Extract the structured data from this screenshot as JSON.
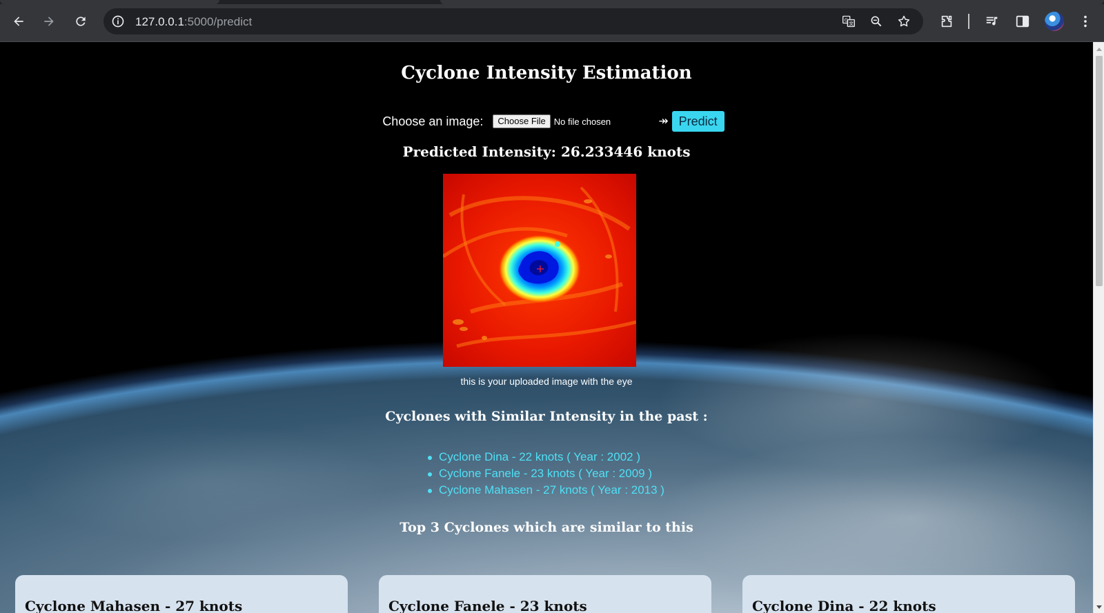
{
  "browser": {
    "url_host": "127.0.0.1",
    "url_path": ":5000/predict",
    "icons": [
      "back-icon",
      "forward-icon",
      "reload-icon",
      "site-info-icon",
      "translate-icon",
      "zoom-icon",
      "bookmark-star-icon",
      "extensions-icon",
      "media-controls-icon",
      "side-panel-icon",
      "profile-avatar",
      "menu-icon"
    ]
  },
  "page": {
    "title": "Cyclone Intensity Estimation",
    "upload": {
      "label": "Choose an image:",
      "choose_button": "Choose File",
      "file_status": "No file chosen",
      "arrow": "↠",
      "predict_button": "Predict"
    },
    "predicted_intensity": "Predicted Intensity: 26.233446 knots",
    "image_caption": "this is your uploaded image with the eye",
    "similar_heading": "Cyclones with Similar Intensity in the past :",
    "similar_list": [
      "Cyclone Dina - 22 knots ( Year : 2002 )",
      "Cyclone Fanele - 23 knots ( Year : 2009 )",
      "Cyclone Mahasen - 27 knots ( Year : 2013 )"
    ],
    "top3_heading": "Top 3 Cyclones which are similar to this",
    "cards": [
      "Cyclone Mahasen - 27 knots",
      "Cyclone Fanele - 23 knots",
      "Cyclone Dina - 22 knots"
    ]
  },
  "colors": {
    "accent": "#3ad6f0",
    "link_cyan": "#4fe0f5",
    "card_bg": "#d6e2ee",
    "chrome_bg": "#35363a"
  }
}
